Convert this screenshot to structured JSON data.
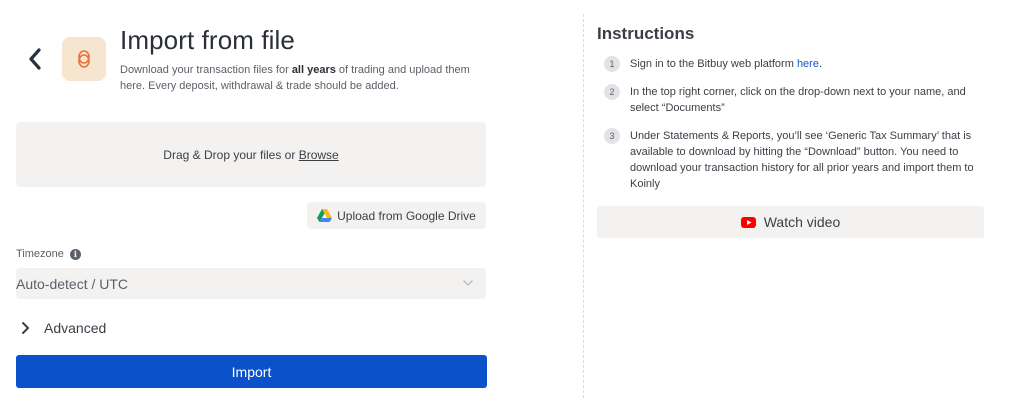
{
  "header": {
    "title": "Import from file",
    "subtitle_pre": "Download your transaction files for ",
    "subtitle_bold": "all years",
    "subtitle_post": " of trading and upload them here. Every deposit, withdrawal & trade should be added."
  },
  "dropzone": {
    "text": "Drag & Drop your files or ",
    "browse_label": "Browse"
  },
  "google_drive": {
    "label": "Upload from Google Drive"
  },
  "timezone": {
    "label": "Timezone",
    "selected": "Auto-detect / UTC"
  },
  "advanced": {
    "label": "Advanced"
  },
  "import_button": {
    "label": "Import"
  },
  "instructions": {
    "title": "Instructions",
    "steps": [
      {
        "num": "1",
        "text": "Sign in to the Bitbuy web platform ",
        "link": "here",
        "suffix": "."
      },
      {
        "num": "2",
        "text": "In the top right corner, click on the drop-down next to your name, and select “Documents”"
      },
      {
        "num": "3",
        "text": "Under Statements & Reports, you’ll see ‘Generic Tax Summary’ that is available to download by hitting the “Download” button. You need to download your transaction history for all prior years and import them to Koinly"
      }
    ],
    "video_label": "Watch video"
  },
  "icons": {
    "back": "chevron-left-icon",
    "logo": "bitbuy-logo",
    "info": "info-icon",
    "select_chevron": "chevron-down-icon",
    "advanced": "chevron-right-icon",
    "drive": "google-drive-icon",
    "video": "youtube-icon"
  },
  "colors": {
    "primary_button": "#0b51c9",
    "logo_tile": "#f6e5cf",
    "logo_accent": "#e8713c",
    "link": "#1a56d6",
    "youtube_red": "#ff0000"
  }
}
